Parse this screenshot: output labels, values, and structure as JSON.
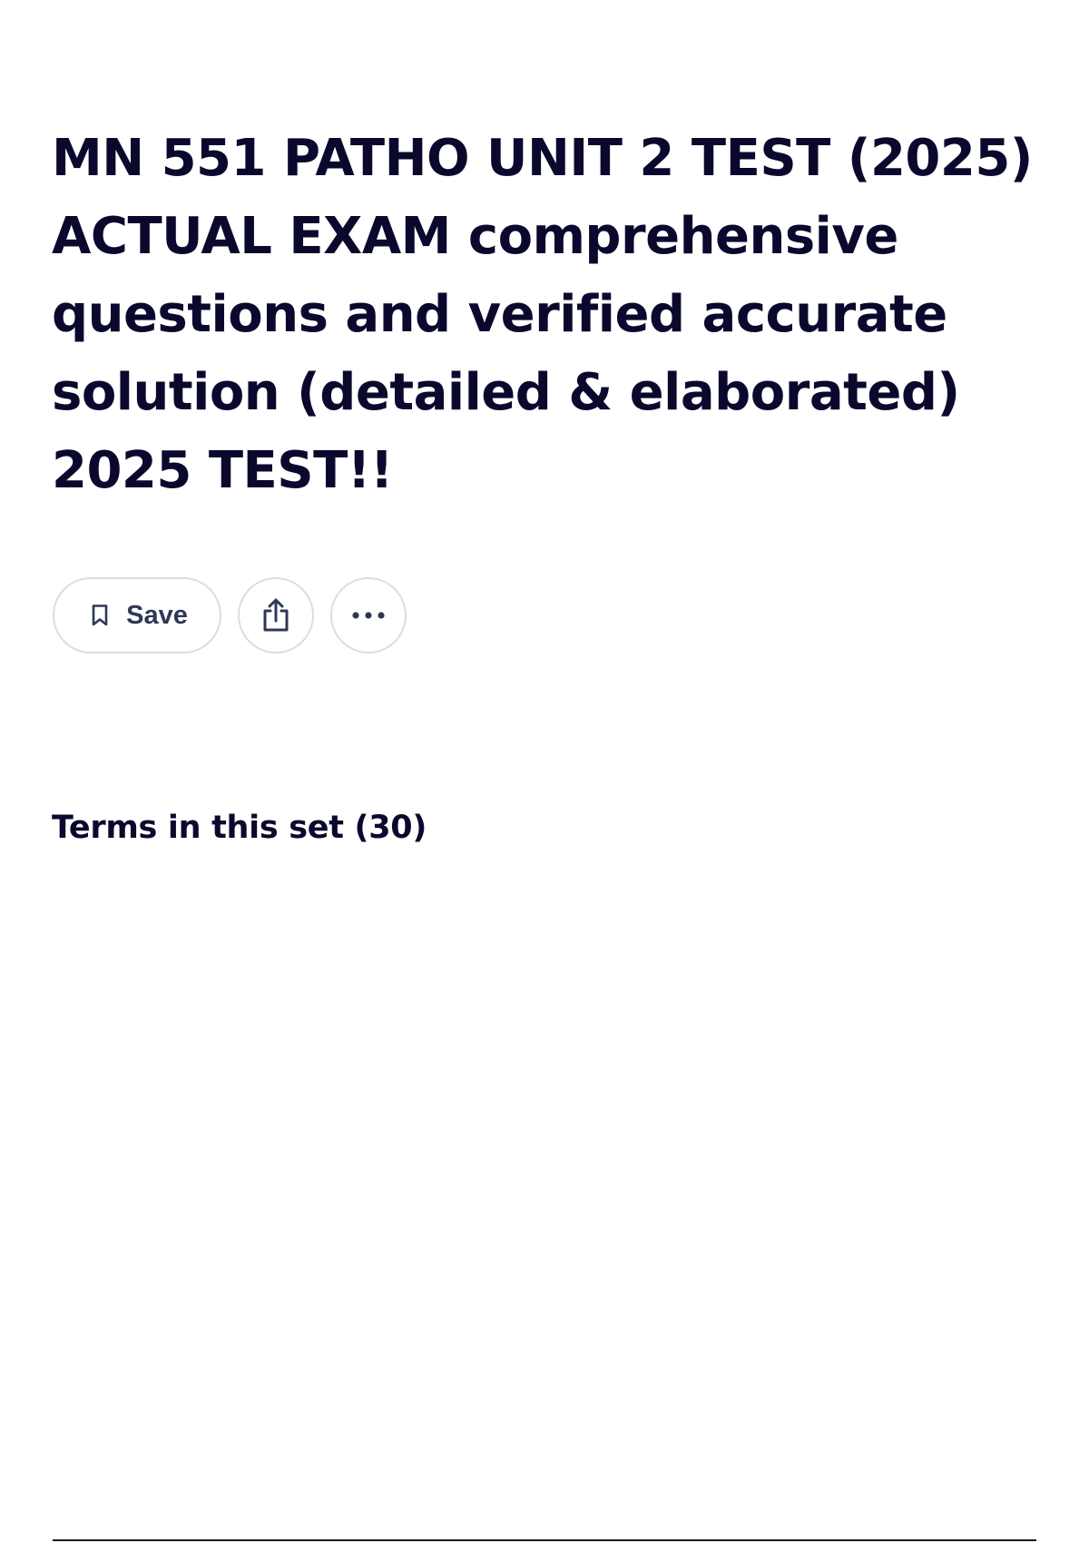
{
  "set": {
    "title": "MN 551 PATHO UNIT 2 TEST (2025) ACTUAL EXAM comprehensive questions and verified accurate solution (detailed & elaborated) 2025 TEST!!"
  },
  "actions": {
    "save_label": "Save",
    "save_icon": "bookmark-icon",
    "share_icon": "share-icon",
    "more_icon": "more-horizontal-icon"
  },
  "terms": {
    "heading": "Terms in this set (30)"
  },
  "colors": {
    "text": "#0a092d",
    "button_text": "#2e3856",
    "button_border": "#d9dde8"
  }
}
